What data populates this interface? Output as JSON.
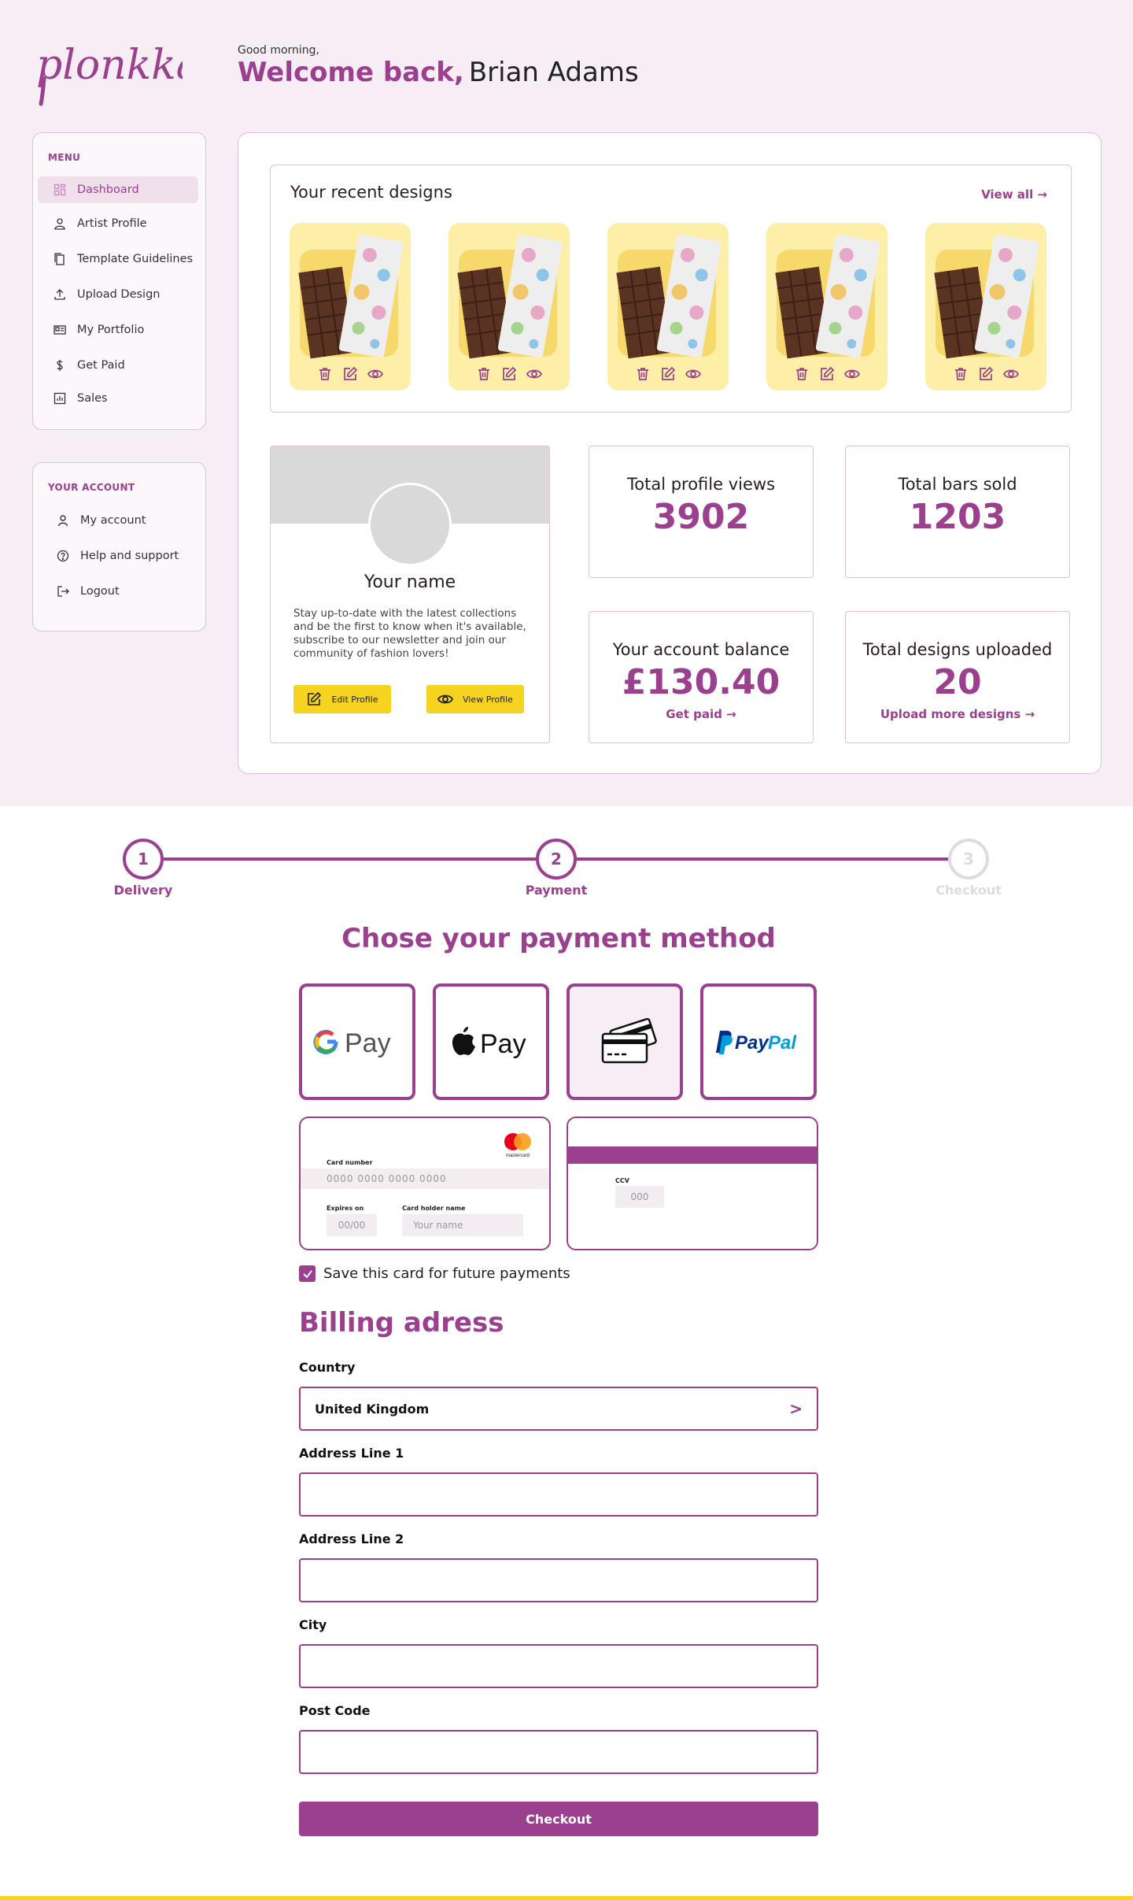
{
  "brand": {
    "logo_text": "plonkkaa"
  },
  "header": {
    "greeting": "Good morning,",
    "welcome": "Welcome back,",
    "user_name": "Brian Adams"
  },
  "sidebar": {
    "menu_title": "MENU",
    "items": [
      {
        "label": "Dashboard",
        "icon": "dashboard-icon"
      },
      {
        "label": "Artist Profile",
        "icon": "user-icon"
      },
      {
        "label": "Template Guidelines",
        "icon": "documents-icon"
      },
      {
        "label": "Upload Design",
        "icon": "upload-icon"
      },
      {
        "label": "My Portfolio",
        "icon": "portfolio-icon"
      },
      {
        "label": "Get Paid",
        "icon": "dollar-icon"
      },
      {
        "label": "Sales",
        "icon": "chart-icon"
      }
    ],
    "account_title": "YOUR ACCOUNT",
    "account_items": [
      {
        "label": "My account",
        "icon": "person-icon"
      },
      {
        "label": "Help and support",
        "icon": "help-icon"
      },
      {
        "label": "Logout",
        "icon": "logout-icon"
      }
    ]
  },
  "recent": {
    "title": "Your recent designs",
    "view_all": "View all →",
    "count": 5
  },
  "profile": {
    "name": "Your name",
    "description": "Stay up-to-date with the latest collections and be the first to know when it's available, subscribe to our newsletter and join our community of fashion lovers!",
    "edit_label": "Edit Profile",
    "view_label": "View Profile"
  },
  "stats": {
    "views_label": "Total profile views",
    "views_value": "3902",
    "bars_label": "Total bars sold",
    "bars_value": "1203",
    "balance_label": "Your account balance",
    "balance_value": "£130.40",
    "balance_link": "Get paid →",
    "designs_label": "Total designs uploaded",
    "designs_value": "20",
    "designs_link": "Upload more designs →"
  },
  "checkout": {
    "steps": [
      {
        "number": "1",
        "label": "Delivery",
        "state": "complete"
      },
      {
        "number": "2",
        "label": "Payment",
        "state": "active"
      },
      {
        "number": "3",
        "label": "Checkout",
        "state": "inactive"
      }
    ],
    "payment_title": "Chose your payment method",
    "payment_options": [
      "google-pay",
      "apple-pay",
      "card",
      "paypal"
    ],
    "card": {
      "brand": "mastercard",
      "number_label": "Card number",
      "number_placeholder": "0000  0000  0000  0000",
      "expires_label": "Expires on",
      "expires_placeholder": "00/00",
      "holder_label": "Card holder name",
      "holder_placeholder": "Your name",
      "ccv_label": "CCV",
      "ccv_placeholder": "000"
    },
    "save_card_label": "Save this card for future payments",
    "billing_title": "Billing adress",
    "country_label": "Country",
    "country_value": "United  Kingdom",
    "address1_label": "Address Line 1",
    "address2_label": "Address Line 2",
    "city_label": "City",
    "postcode_label": "Post Code",
    "checkout_label": "Checkout"
  },
  "colors": {
    "accent": "#9b3f8f",
    "background": "#f7eef5",
    "highlight": "#f5d31e"
  }
}
